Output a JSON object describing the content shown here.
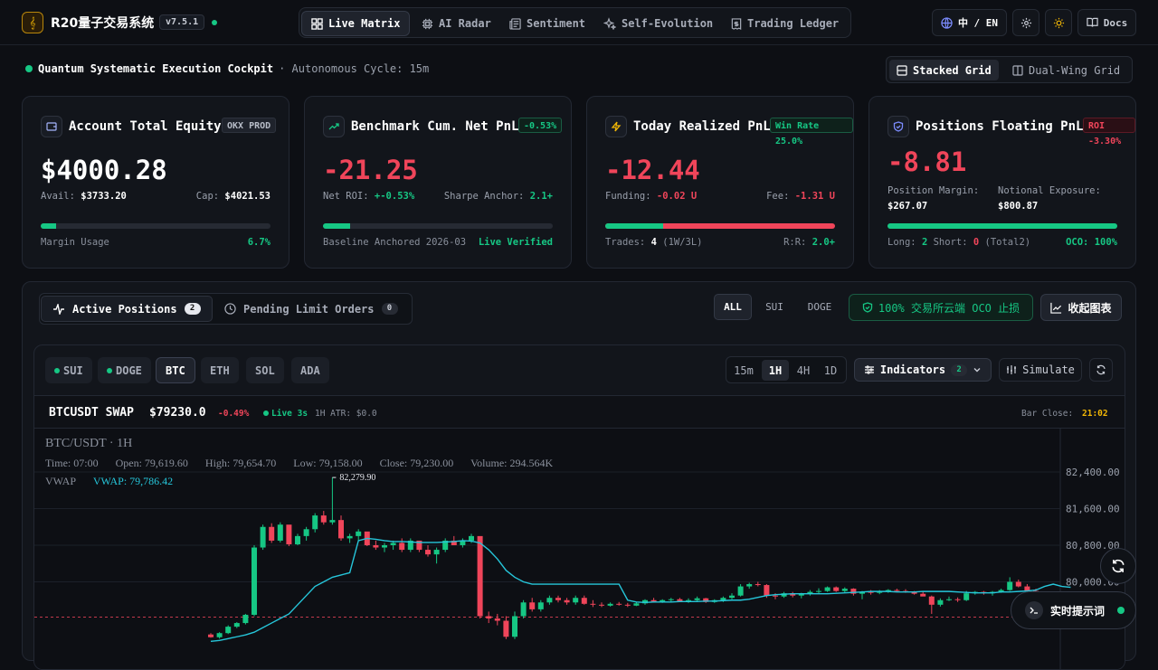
{
  "header": {
    "logo_glyph": "𝄞",
    "title": "R20量子交易系统",
    "version": "v7.5.1",
    "nav": [
      {
        "label": "Live Matrix",
        "icon": "grid-icon",
        "active": true
      },
      {
        "label": "AI Radar",
        "icon": "cpu-icon"
      },
      {
        "label": "Sentiment",
        "icon": "newspaper-icon"
      },
      {
        "label": "Self-Evolution",
        "icon": "sparkles-icon"
      },
      {
        "label": "Trading Ledger",
        "icon": "receipt-icon"
      }
    ],
    "lang": "中 / EN",
    "docs": "Docs"
  },
  "subheader": {
    "title": "Quantum Systematic Execution Cockpit",
    "cycle": "· Autonomous Cycle: 15m",
    "views": [
      "Stacked Grid",
      "Dual-Wing Grid"
    ]
  },
  "cards": [
    {
      "title": "Account Total Equity",
      "badge": "OKX PROD",
      "value": "$4000.28",
      "row1_label": "Avail:",
      "row1_value": "$3733.20",
      "row1r_label": "Cap:",
      "row1r_value": "$4021.53",
      "progress": 0.067,
      "foot_left": "Margin Usage",
      "foot_right": "6.7%"
    },
    {
      "title": "Benchmark Cum. Net PnL",
      "badge": "-0.53%",
      "value": "-21.25",
      "row1_label": "Net ROI:",
      "row1_value": "+-0.53%",
      "row1r_label": "Sharpe Anchor:",
      "row1r_value": "2.1+",
      "progress": 0.12,
      "foot_left": "Baseline Anchored 2026-03",
      "foot_right": "Live Verified"
    },
    {
      "title": "Today Realized PnL",
      "badge": "Win Rate 25.0%",
      "value": "-12.44",
      "row1_label": "Funding:",
      "row1_value": "-0.02 U",
      "row1r_label": "Fee:",
      "row1r_value": "-1.31 U",
      "progress": 0.25,
      "foot_left_label": "Trades:",
      "foot_left_value": "4",
      "foot_left_extra": "(1W/3L)",
      "foot_right_label": "R:R:",
      "foot_right_value": "2.0+"
    },
    {
      "title": "Positions Floating PnL",
      "badge": "ROI -3.30%",
      "value": "-8.81",
      "margin_label": "Position Margin:",
      "margin_value": "$267.07",
      "exposure_label": "Notional Exposure:",
      "exposure_value": "$800.87",
      "progress": 1.0,
      "long_label": "Long:",
      "long_value": "2",
      "short_label": "Short:",
      "short_value": "0",
      "total": "(Total2)",
      "oco": "OCO: 100%"
    }
  ],
  "panel": {
    "tabs": [
      {
        "label": "Active Positions",
        "count": "2",
        "active": true
      },
      {
        "label": "Pending Limit Orders",
        "count": "0"
      }
    ],
    "filters": [
      "ALL",
      "SUI",
      "DOGE"
    ],
    "oco_label": "100% 交易所云端 OCO 止损",
    "collapse_label": "收起图表"
  },
  "chart_toolbar": {
    "coins": [
      "SUI",
      "DOGE",
      "BTC",
      "ETH",
      "SOL",
      "ADA"
    ],
    "timeframes": [
      "15m",
      "1H",
      "4H",
      "1D"
    ],
    "indicators_label": "Indicators",
    "indicators_count": "2",
    "simulate_label": "Simulate"
  },
  "ticker": {
    "symbol": "BTCUSDT SWAP",
    "price": "$79230.0",
    "change": "-0.49%",
    "live": "Live 3s",
    "atr": "1H ATR: $0.0",
    "bar_close_label": "Bar Close:",
    "bar_close": "21:02"
  },
  "chart_legend": {
    "title": "BTC/USDT · 1H",
    "time": "Time: 07:00",
    "open": "Open: 79,619.60",
    "high": "High: 79,654.70",
    "low": "Low: 79,158.00",
    "close": "Close: 79,230.00",
    "volume": "Volume: 294.564K",
    "vwap_label": "VWAP",
    "vwap_value": "VWAP: 79,786.42",
    "high_marker": "82,279.90"
  },
  "chart_data": {
    "type": "candlestick",
    "symbol": "BTC/USDT",
    "interval": "1H",
    "y_ticks": [
      82400,
      81600,
      80800,
      80000
    ],
    "price_line": 79230,
    "max_high_label": 82279.9,
    "colors": {
      "up": "#16c784",
      "down": "#f0455a",
      "vwap": "#26c6da"
    },
    "candles": [
      [
        78850,
        78880,
        78780,
        78790
      ],
      [
        78790,
        78900,
        78760,
        78880
      ],
      [
        78880,
        79050,
        78860,
        79020
      ],
      [
        79020,
        79120,
        78990,
        79100
      ],
      [
        79100,
        79300,
        79070,
        79280
      ],
      [
        79280,
        80800,
        79250,
        80750
      ],
      [
        80750,
        81250,
        80700,
        81200
      ],
      [
        81200,
        81280,
        80850,
        80900
      ],
      [
        80900,
        81300,
        80860,
        81250
      ],
      [
        81250,
        81000,
        80780,
        80820
      ],
      [
        80820,
        81050,
        80800,
        81000
      ],
      [
        81000,
        81200,
        80900,
        81150
      ],
      [
        81150,
        81500,
        81080,
        81450
      ],
      [
        81450,
        81550,
        81250,
        81300
      ],
      [
        81300,
        82280,
        81250,
        81350
      ],
      [
        81350,
        81450,
        80900,
        80950
      ],
      [
        80950,
        81050,
        80850,
        81000
      ],
      [
        81000,
        81150,
        80900,
        81100
      ],
      [
        81100,
        81000,
        80780,
        80800
      ],
      [
        80800,
        80900,
        80700,
        80750
      ],
      [
        80750,
        80850,
        80650,
        80800
      ],
      [
        80800,
        80900,
        80700,
        80850
      ],
      [
        80850,
        80950,
        80650,
        80700
      ],
      [
        80700,
        80950,
        80650,
        80900
      ],
      [
        80900,
        80850,
        80650,
        80700
      ],
      [
        80700,
        80800,
        80550,
        80600
      ],
      [
        80600,
        80750,
        80400,
        80700
      ],
      [
        80700,
        80950,
        80650,
        80900
      ],
      [
        80900,
        81000,
        80800,
        80800
      ],
      [
        80800,
        80950,
        80750,
        80900
      ],
      [
        80900,
        81050,
        80850,
        81000
      ],
      [
        81000,
        80950,
        79200,
        79250
      ],
      [
        79250,
        79350,
        79100,
        79200
      ],
      [
        79200,
        79300,
        79050,
        79150
      ],
      [
        79150,
        79250,
        78750,
        78800
      ],
      [
        78800,
        79350,
        78750,
        79250
      ],
      [
        79250,
        79600,
        79200,
        79550
      ],
      [
        79550,
        79650,
        79350,
        79400
      ],
      [
        79400,
        79600,
        79350,
        79550
      ],
      [
        79550,
        79700,
        79500,
        79650
      ],
      [
        79650,
        79700,
        79550,
        79600
      ],
      [
        79600,
        79650,
        79500,
        79550
      ],
      [
        79550,
        79700,
        79500,
        79650
      ],
      [
        79650,
        79700,
        79500,
        79520
      ],
      [
        79520,
        79600,
        79450,
        79500
      ],
      [
        79500,
        79550,
        79450,
        79480
      ],
      [
        79480,
        79550,
        79460,
        79520
      ],
      [
        79520,
        79560,
        79480,
        79500
      ],
      [
        79500,
        79540,
        79450,
        79480
      ],
      [
        79480,
        79560,
        79470,
        79530
      ],
      [
        79530,
        79620,
        79500,
        79600
      ],
      [
        79600,
        79650,
        79550,
        79570
      ],
      [
        79570,
        79620,
        79540,
        79600
      ],
      [
        79600,
        79650,
        79560,
        79620
      ],
      [
        79620,
        79650,
        79560,
        79580
      ],
      [
        79580,
        79640,
        79540,
        79600
      ],
      [
        79600,
        79680,
        79570,
        79640
      ],
      [
        79640,
        79650,
        79540,
        79560
      ],
      [
        79560,
        79620,
        79540,
        79600
      ],
      [
        79600,
        79680,
        79560,
        79650
      ],
      [
        79650,
        79750,
        79620,
        79700
      ],
      [
        79700,
        79950,
        79680,
        79900
      ],
      [
        79900,
        79980,
        79850,
        79950
      ],
      [
        79950,
        80000,
        79900,
        79930
      ],
      [
        79930,
        79950,
        79650,
        79700
      ],
      [
        79700,
        79750,
        79620,
        79680
      ],
      [
        79680,
        79780,
        79650,
        79750
      ],
      [
        79750,
        79780,
        79660,
        79700
      ],
      [
        79700,
        79760,
        79640,
        79740
      ],
      [
        79740,
        79820,
        79700,
        79780
      ],
      [
        79780,
        79860,
        79750,
        79800
      ],
      [
        79800,
        79900,
        79780,
        79880
      ],
      [
        79880,
        79900,
        79780,
        79800
      ],
      [
        79800,
        79880,
        79760,
        79850
      ],
      [
        79850,
        79860,
        79700,
        79740
      ],
      [
        79740,
        79800,
        79620,
        79780
      ],
      [
        79780,
        79820,
        79720,
        79760
      ],
      [
        79760,
        79820,
        79730,
        79790
      ],
      [
        79790,
        79840,
        79760,
        79820
      ],
      [
        79820,
        79850,
        79780,
        79800
      ],
      [
        79800,
        79840,
        79760,
        79780
      ],
      [
        79780,
        79800,
        79720,
        79740
      ],
      [
        79740,
        79790,
        79700,
        79680
      ],
      [
        79680,
        79700,
        79300,
        79500
      ],
      [
        79500,
        79640,
        79460,
        79600
      ],
      [
        79600,
        79680,
        79580,
        79620
      ],
      [
        79620,
        79660,
        79560,
        79600
      ],
      [
        79600,
        79800,
        79580,
        79750
      ],
      [
        79750,
        79800,
        79720,
        79780
      ],
      [
        79780,
        79800,
        79720,
        79750
      ],
      [
        79750,
        79800,
        79700,
        79780
      ],
      [
        79780,
        79850,
        79760,
        79820
      ],
      [
        79820,
        80100,
        79800,
        80000
      ],
      [
        80000,
        80050,
        79880,
        79900
      ],
      [
        79900,
        79950,
        79750,
        79800
      ],
      [
        79800,
        79850,
        79650,
        79720
      ],
      [
        79720,
        79780,
        79550,
        79600
      ],
      [
        79600,
        79700,
        79560,
        79650
      ],
      [
        79650,
        79750,
        79580,
        79620
      ],
      [
        79620,
        79700,
        79500,
        79580
      ]
    ],
    "vwap": [
      78700,
      78720,
      78760,
      78800,
      78840,
      78900,
      79000,
      79100,
      79200,
      79300,
      79500,
      79700,
      79900,
      80000,
      80100,
      80150,
      80200,
      80900,
      80950,
      80930,
      80900,
      80880,
      80880,
      80870,
      80860,
      80860,
      80860,
      80870,
      80880,
      80900,
      80890,
      80850,
      80700,
      80500,
      80250,
      80100,
      80000,
      79950,
      79950,
      79950,
      79950,
      79950,
      79950,
      79950,
      79950,
      79950,
      79950,
      79950,
      79600,
      79560,
      79550,
      79560,
      79560,
      79560,
      79570,
      79570,
      79570,
      79580,
      79580,
      79590,
      79600,
      79600,
      79620,
      79660,
      79700,
      79720,
      79730,
      79740,
      79740,
      79740,
      79740,
      79740,
      79750,
      79760,
      79770,
      79780,
      79790,
      79790,
      79790,
      79780,
      79780,
      79780,
      79790,
      79790,
      79790,
      79790,
      79780,
      79770,
      79760,
      79760,
      79760,
      79780,
      79780,
      79790,
      79800,
      79820,
      79900,
      79950,
      79900,
      79880
    ]
  }
}
